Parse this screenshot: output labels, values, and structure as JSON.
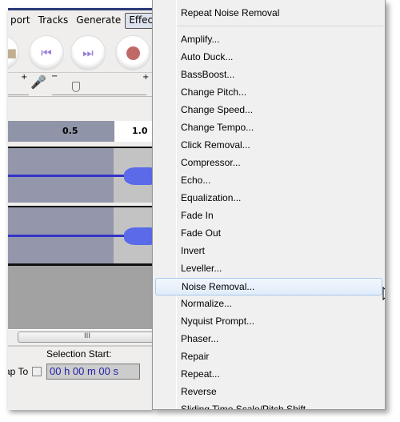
{
  "menubar": {
    "items": [
      "port",
      "Tracks",
      "Generate",
      "Effect"
    ],
    "active": "Effect"
  },
  "toolbar": {
    "buttons": [
      {
        "icon": "stop-icon"
      },
      {
        "icon": "skip-start-icon"
      },
      {
        "icon": "skip-end-icon"
      },
      {
        "icon": "record-icon"
      }
    ]
  },
  "ruler": {
    "ticks": [
      "0.5",
      "1.0"
    ]
  },
  "scrollbar": {
    "thumb_label": "III"
  },
  "selection": {
    "label": "Selection Start:",
    "snap_label": "ap To",
    "snap_checked": false,
    "time_value": "00 h 00 m 00 s"
  },
  "menu": {
    "repeat": "Repeat Noise Removal",
    "items": [
      "Amplify...",
      "Auto Duck...",
      "BassBoost...",
      "Change Pitch...",
      "Change Speed...",
      "Change Tempo...",
      "Click Removal...",
      "Compressor...",
      "Echo...",
      "Equalization...",
      "Fade In",
      "Fade Out",
      "Invert",
      "Leveller...",
      "Noise Removal...",
      "Normalize...",
      "Nyquist Prompt...",
      "Phaser...",
      "Repair",
      "Repeat...",
      "Reverse",
      "Sliding Time Scale/Pitch Shift"
    ],
    "highlighted": "Noise Removal..."
  },
  "colors": {
    "waveform": "#3434c8",
    "selection": "#9497ab",
    "highlight": "#e0ecfa"
  }
}
